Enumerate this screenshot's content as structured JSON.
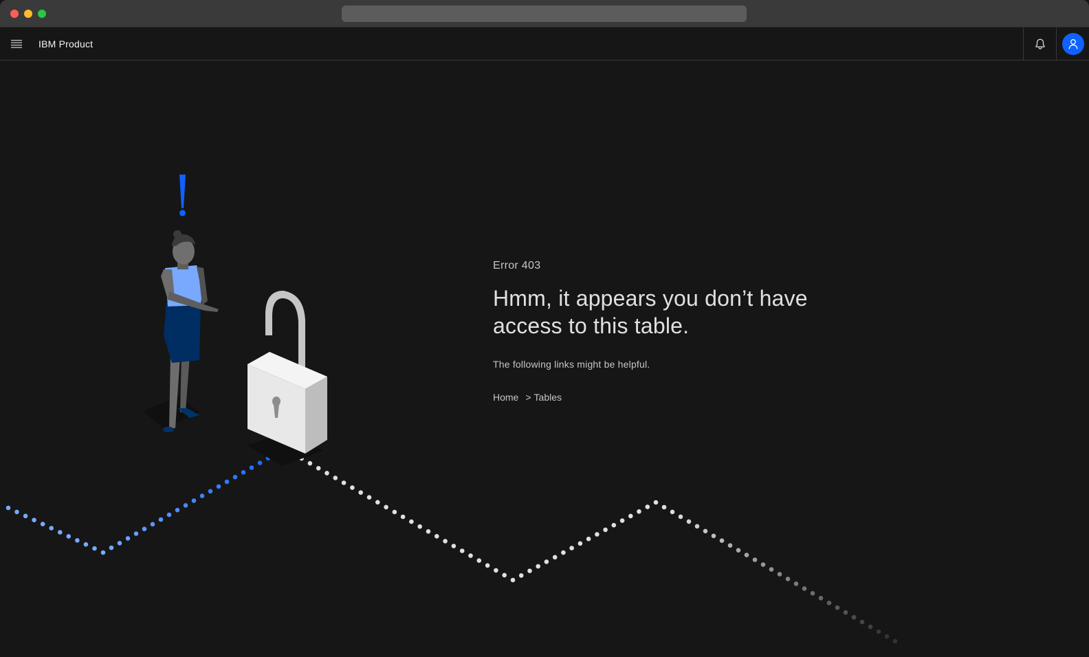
{
  "window": {
    "controls": [
      "close",
      "minimize",
      "maximize"
    ]
  },
  "header": {
    "menu_icon": "hamburger-menu-icon",
    "app_name": "IBM Product",
    "actions": [
      {
        "name": "notification-button",
        "icon": "bell-icon"
      },
      {
        "name": "user-avatar",
        "icon": "user-icon"
      }
    ]
  },
  "error": {
    "code": "Error 403",
    "headline": "Hmm, it appears you don’t have access to this table.",
    "helper": "The following links might be helpful.",
    "breadcrumb": {
      "items": [
        "Home",
        "Tables"
      ],
      "separator": ">"
    }
  },
  "colors": {
    "background": "#161616",
    "accent": "#0f62fe",
    "text_primary": "#e0e0e0",
    "text_secondary": "#c6c6c6"
  }
}
